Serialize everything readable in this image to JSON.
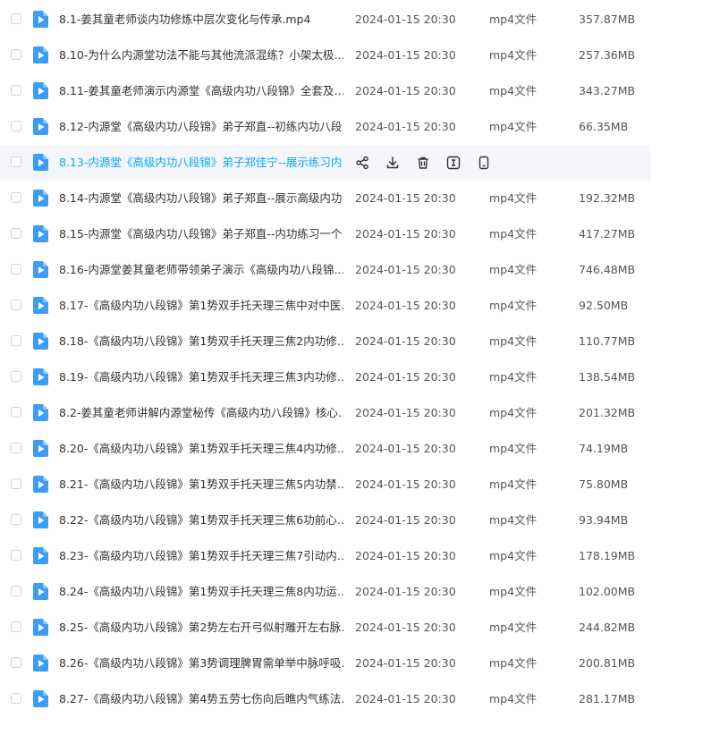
{
  "file_type_icon": "video-file-icon",
  "colors": {
    "icon_blue": "#3b9df7",
    "hover_text": "#06a7ff",
    "hover_bg": "#f5f6fa"
  },
  "hover_actions": [
    "share-icon",
    "download-icon",
    "delete-icon",
    "rename-icon",
    "mobile-icon"
  ],
  "files": [
    {
      "name": "8.1-姜其童老师谈内功修炼中层次变化与传承.mp4",
      "date": "2024-01-15 20:30",
      "type": "mp4文件",
      "size": "357.87MB"
    },
    {
      "name": "8.10-为什么内源堂功法不能与其他流派混练？小架太极…",
      "date": "2024-01-15 20:30",
      "type": "mp4文件",
      "size": "257.36MB"
    },
    {
      "name": "8.11-姜其童老师演示内源堂《高级内功八段锦》全套及…",
      "date": "2024-01-15 20:30",
      "type": "mp4文件",
      "size": "343.27MB"
    },
    {
      "name": "8.12-内源堂《高级内功八段锦》弟子郑直--初练内功八段…",
      "date": "2024-01-15 20:30",
      "type": "mp4文件",
      "size": "66.35MB"
    },
    {
      "name": "8.13-内源堂《高级内功八段锦》弟子郑佳宁--展示练习内…",
      "hover": true
    },
    {
      "name": "8.14-内源堂《高级内功八段锦》弟子郑直--展示高级内功…",
      "date": "2024-01-15 20:30",
      "type": "mp4文件",
      "size": "192.32MB"
    },
    {
      "name": "8.15-内源堂《高级内功八段锦》弟子郑直--内功练习一个…",
      "date": "2024-01-15 20:30",
      "type": "mp4文件",
      "size": "417.27MB"
    },
    {
      "name": "8.16-内源堂姜其童老师带领弟子演示《高级内功八段锦…",
      "date": "2024-01-15 20:30",
      "type": "mp4文件",
      "size": "746.48MB"
    },
    {
      "name": "8.17-《高级内功八段锦》第1势双手托天理三焦中对中医…",
      "date": "2024-01-15 20:30",
      "type": "mp4文件",
      "size": "92.50MB"
    },
    {
      "name": "8.18-《高级内功八段锦》第1势双手托天理三焦2内功修…",
      "date": "2024-01-15 20:30",
      "type": "mp4文件",
      "size": "110.77MB"
    },
    {
      "name": "8.19-《高级内功八段锦》第1势双手托天理三焦3内功修…",
      "date": "2024-01-15 20:30",
      "type": "mp4文件",
      "size": "138.54MB"
    },
    {
      "name": "8.2-姜其童老师讲解内源堂秘传《高级内功八段锦》核心…",
      "date": "2024-01-15 20:30",
      "type": "mp4文件",
      "size": "201.32MB"
    },
    {
      "name": "8.20-《高级内功八段锦》第1势双手托天理三焦4内功修…",
      "date": "2024-01-15 20:30",
      "type": "mp4文件",
      "size": "74.19MB"
    },
    {
      "name": "8.21-《高级内功八段锦》第1势双手托天理三焦5内功禁…",
      "date": "2024-01-15 20:30",
      "type": "mp4文件",
      "size": "75.80MB"
    },
    {
      "name": "8.22-《高级内功八段锦》第1势双手托天理三焦6功前心…",
      "date": "2024-01-15 20:30",
      "type": "mp4文件",
      "size": "93.94MB"
    },
    {
      "name": "8.23-《高级内功八段锦》第1势双手托天理三焦7引动内…",
      "date": "2024-01-15 20:30",
      "type": "mp4文件",
      "size": "178.19MB"
    },
    {
      "name": "8.24-《高级内功八段锦》第1势双手托天理三焦8内功运…",
      "date": "2024-01-15 20:30",
      "type": "mp4文件",
      "size": "102.00MB"
    },
    {
      "name": "8.25-《高级内功八段锦》第2势左右开弓似射雕开左右脉…",
      "date": "2024-01-15 20:30",
      "type": "mp4文件",
      "size": "244.82MB"
    },
    {
      "name": "8.26-《高级内功八段锦》第3势调理脾胃需单举中脉呼吸…",
      "date": "2024-01-15 20:30",
      "type": "mp4文件",
      "size": "200.81MB"
    },
    {
      "name": "8.27-《高级内功八段锦》第4势五劳七伤向后瞧内气练法…",
      "date": "2024-01-15 20:30",
      "type": "mp4文件",
      "size": "281.17MB"
    }
  ]
}
